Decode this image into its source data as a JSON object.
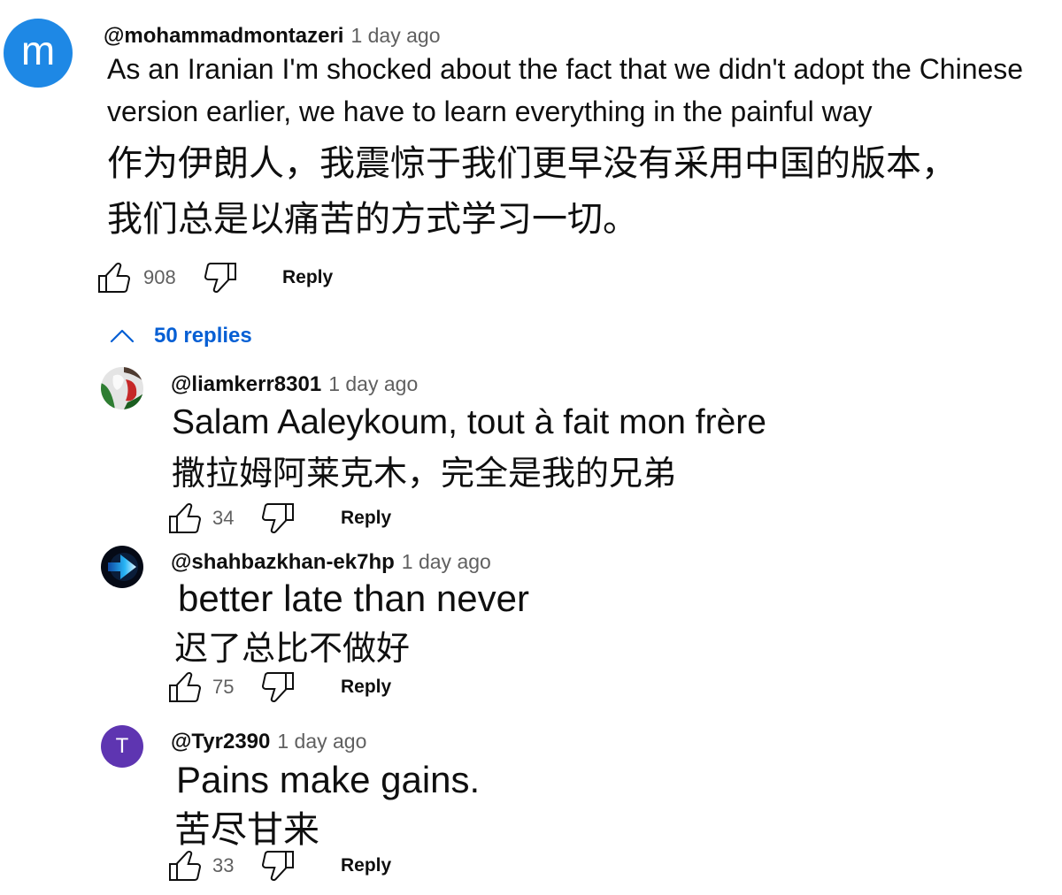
{
  "theme": {
    "background": "#ffffff",
    "text": "#0f0f0f",
    "secondary": "#606060",
    "link": "#065fd4"
  },
  "icons": {
    "like": "thumbs-up-icon",
    "dislike": "thumbs-down-icon",
    "replies_toggle": "chevron-up-icon"
  },
  "comment": {
    "author": "@mohammadmontazeri",
    "time": "1 day ago",
    "avatar_letter": "m",
    "avatar_color": "#1e88e5",
    "text_lines": [
      "As an Iranian I'm shocked about the fact that we didn't adopt the Chinese",
      "version earlier, we have to learn everything in the painful way"
    ],
    "translation_lines": [
      "作为伊朗人，我震惊于我们更早没有采用中国的版本，",
      "我们总是以痛苦的方式学习一切。"
    ],
    "likes": "908",
    "reply_label": "Reply"
  },
  "replies_toggle": {
    "label": "50 replies"
  },
  "replies": [
    {
      "author": "@liamkerr8301",
      "time": "1 day ago",
      "text": "Salam Aaleykoum, tout à fait mon frère",
      "translation": "撒拉姆阿莱克木，完全是我的兄弟",
      "likes": "34",
      "reply_label": "Reply"
    },
    {
      "author": "@shahbazkhan-ek7hp",
      "time": "1 day ago",
      "text": "better late than never",
      "translation": "迟了总比不做好",
      "likes": "75",
      "reply_label": "Reply"
    },
    {
      "author": "@Tyr2390",
      "time": "1 day ago",
      "avatar_letter": "T",
      "avatar_color": "#5e35b1",
      "text": "Pains make gains.",
      "translation": "苦尽甘来",
      "likes": "33",
      "reply_label": "Reply"
    }
  ]
}
